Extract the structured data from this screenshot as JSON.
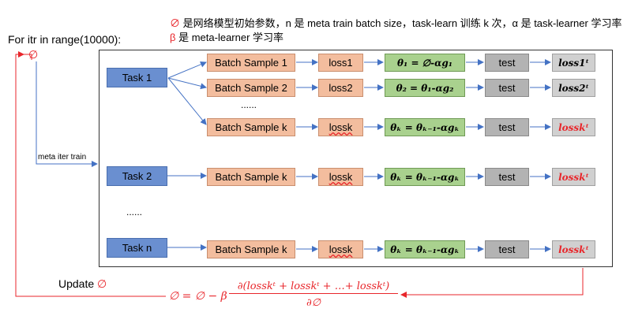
{
  "notes": {
    "line1_symbol": "∅",
    "line1_text": "是网络模型初始参数，n 是 meta train batch size，task-learn 训练 k 次，α 是 task-learner 学习率",
    "line2_symbol": "β",
    "line2_text": "是 meta-learner 学习率"
  },
  "loop_label": "For itr in range(10000):",
  "phi_symbol": "∅",
  "meta_label": "meta iter train",
  "update_label": "Update",
  "update_symbol": "∅",
  "tasks": [
    "Task 1",
    "Task 2",
    "Task n"
  ],
  "dots_v": "......",
  "dots_task": "......",
  "rows": [
    {
      "batch": "Batch Sample 1",
      "loss": "loss1",
      "theta": "θ₁ = ∅-αg₁",
      "test": "test",
      "result": "loss1ᵗ",
      "result_red": false
    },
    {
      "batch": "Batch Sample 2",
      "loss": "loss2",
      "theta": "θ₂ = θ₁-αg₂",
      "test": "test",
      "result": "loss2ᵗ",
      "result_red": false
    },
    {
      "batch": "Batch Sample k",
      "loss": "lossk",
      "theta": "θₖ = θₖ₋₁-αgₖ",
      "test": "test",
      "result": "losskᵗ",
      "result_red": true
    },
    {
      "batch": "Batch Sample k",
      "loss": "lossk",
      "theta": "θₖ = θₖ₋₁-αgₖ",
      "test": "test",
      "result": "losskᵗ",
      "result_red": true
    },
    {
      "batch": "Batch Sample k",
      "loss": "lossk",
      "theta": "θₖ = θₖ₋₁-αgₖ",
      "test": "test",
      "result": "losskᵗ",
      "result_red": true
    }
  ],
  "formula": {
    "lhs": "∅ = ∅ − β",
    "numerator": "∂(losskᵗ + losskᵗ + …+ losskᵗ)",
    "denominator": "∂∅"
  },
  "colors": {
    "task": "#6a8fd0",
    "batch": "#f3bd9e",
    "theta": "#a9d18e",
    "test": "#b3b3b3",
    "result": "#d0d0d0",
    "red": "#e8262b",
    "arrow": "#4472c4"
  }
}
